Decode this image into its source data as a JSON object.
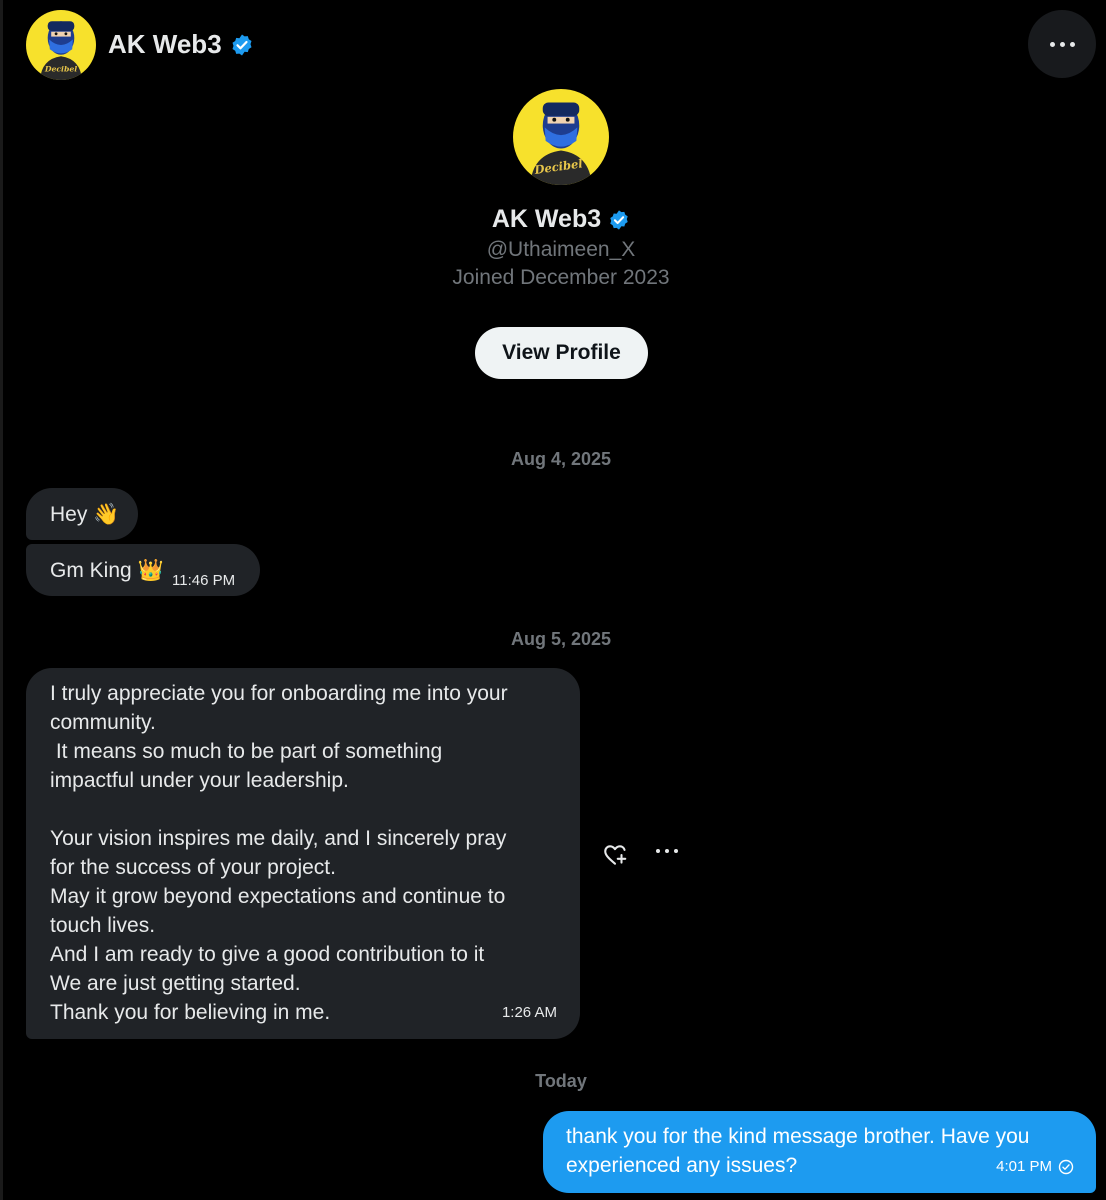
{
  "header": {
    "name": "AK Web3",
    "avatar_icon": "ninja-avatar-icon",
    "verified_icon": "verified-badge-icon",
    "more_icon": "more-options-icon"
  },
  "profile": {
    "name": "AK Web3",
    "handle": "@Uthaimeen_X",
    "joined": "Joined December 2023",
    "view_profile_label": "View Profile",
    "avatar_text": "Decibel"
  },
  "conversation": {
    "date_1": "Aug 4, 2025",
    "msg_1": "Hey 👋",
    "msg_2": "Gm King 👑",
    "msg_2_time": "11:46 PM",
    "date_2": "Aug 5, 2025",
    "msg_3": "I truly appreciate you for onboarding me into your\ncommunity.\n It means so much to be part of something\nimpactful under your leadership.\n\nYour vision inspires me daily, and I sincerely pray\nfor the success of your project.\nMay it grow beyond expectations and continue to\ntouch lives.\nAnd I am ready to give a good contribution to it\nWe are just getting started.\nThank you for believing in me.",
    "msg_3_time": "1:26 AM",
    "react_icon": "heart-plus-icon",
    "msg_more_icon": "more-options-icon",
    "date_3": "Today",
    "msg_4": "thank you for the kind message brother. Have you\nexperienced any issues?",
    "msg_4_time": "4:01 PM",
    "sent_icon": "sent-check-icon"
  },
  "colors": {
    "background": "#000000",
    "bubble_incoming": "#202327",
    "bubble_outgoing": "#1d9bf0",
    "verified": "#1d9bf0",
    "muted_text": "#71767b"
  }
}
